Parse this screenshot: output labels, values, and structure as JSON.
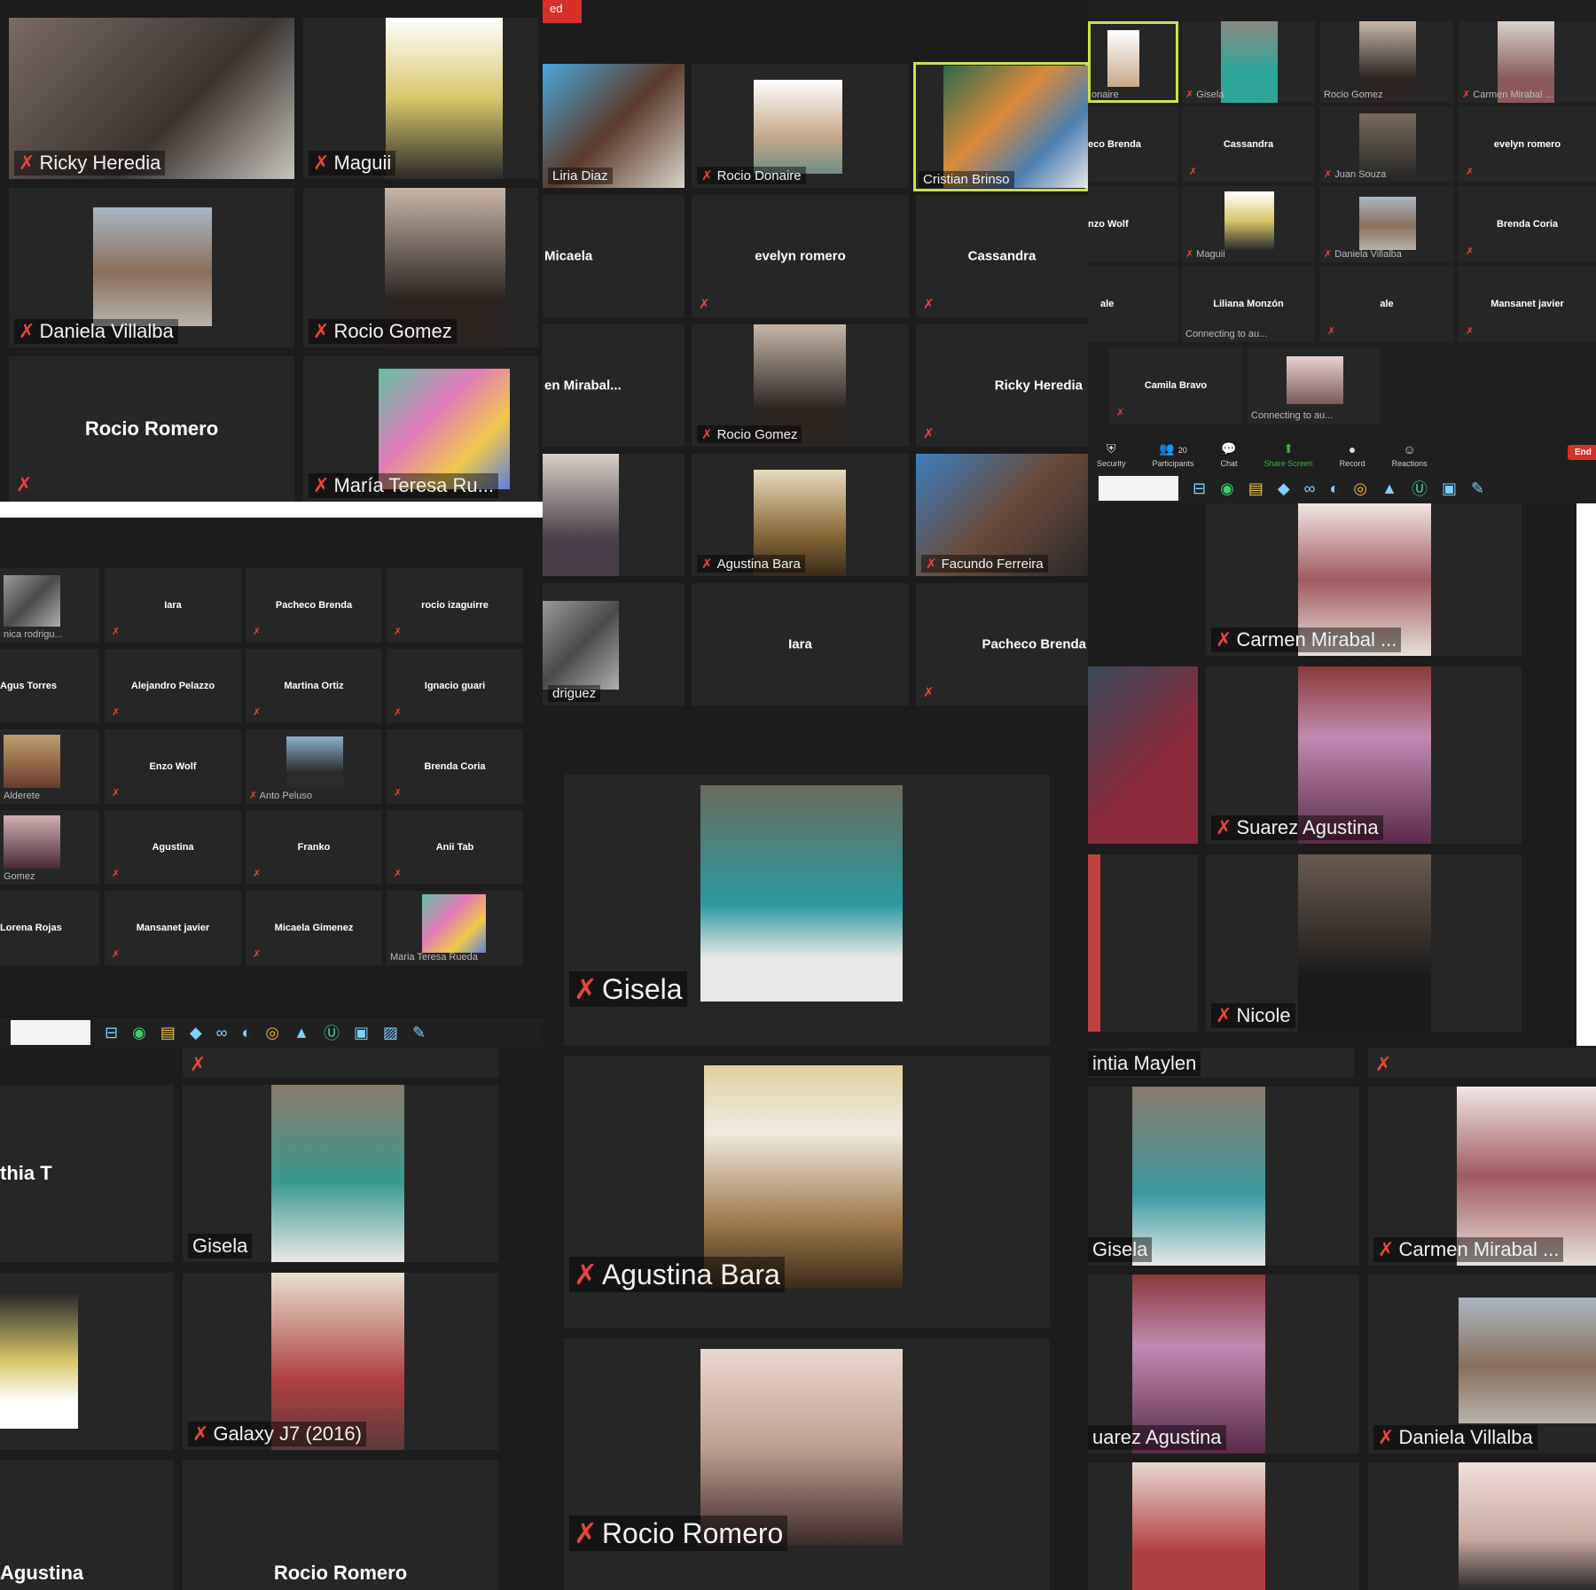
{
  "colors": {
    "accent": "#c9e34a",
    "muted_mic": "#e8453c",
    "share": "#2fb34a",
    "end": "#d9302a"
  },
  "top_left": {
    "tiles": [
      "Ricky Heredia",
      "Maguii",
      "Daniela Villalba",
      "Rocio Gomez",
      "Rocio Romero",
      "María Teresa Ru..."
    ]
  },
  "top_center": {
    "rec_label": "ed",
    "tiles": [
      "Liria Diaz",
      "Rocio Donaire",
      "Cristian Brinso",
      "Micaela",
      "evelyn romero",
      "Cassandra",
      "en  Mirabal...",
      "Rocio Gomez",
      "Ricky Heredia",
      "Agustina Bara",
      "Facundo Ferreira",
      "driguez",
      "Iara",
      "Pacheco Brenda"
    ]
  },
  "top_right": {
    "tiles": [
      "onaire",
      "Gisela",
      "Rocio Gomez",
      "Carmen Mirabal ...",
      "eco Brenda",
      "Cassandra",
      "Juan Souza",
      "evelyn romero",
      "nzo Wolf",
      "Maguii",
      "Daniela Villalba",
      "Brenda Coria",
      "ale",
      "Liliana Monzón",
      "ale",
      "Mansanet javier",
      "Camila Bravo",
      "Connecting to au..."
    ],
    "liliana_sub": "Connecting to au...",
    "toolbar": {
      "security": "Security",
      "participants": "Participants",
      "participants_count": "20",
      "chat": "Chat",
      "share": "Share Screen",
      "record": "Record",
      "reactions": "Reactions",
      "end": "End"
    }
  },
  "mid_left": {
    "tiles": [
      "nica rodrigu...",
      "Iara",
      "Pacheco Brenda",
      "rocio izaguirre",
      "Agus Torres",
      "Alejandro Pelazzo",
      "Martina Ortiz",
      "Ignacio guari",
      "Alderete",
      "Enzo Wolf",
      "Anto Peluso",
      "Brenda Coria",
      "Gomez",
      "Agustina",
      "Franko",
      "Anii Tab",
      "Lorena Rojas",
      "Mansanet javier",
      "Micaela Gimenez",
      "Maria Teresa Rueda"
    ]
  },
  "mid_right": {
    "tiles": [
      "Carmen Mirabal ...",
      "Suarez Agustina",
      "Nicole"
    ]
  },
  "bottom_left": {
    "tiles": [
      "thia T",
      "Gisela",
      "Galaxy J7 (2016)",
      "Agustina",
      "Rocio Romero"
    ]
  },
  "bottom_center": {
    "tiles": [
      "Gisela",
      "Agustina Bara",
      "Rocio Romero"
    ]
  },
  "bottom_right": {
    "tiles": [
      "intia Maylen",
      "Gisela",
      "Carmen Mirabal ...",
      "uarez Agustina",
      "Daniela Villalba"
    ]
  }
}
